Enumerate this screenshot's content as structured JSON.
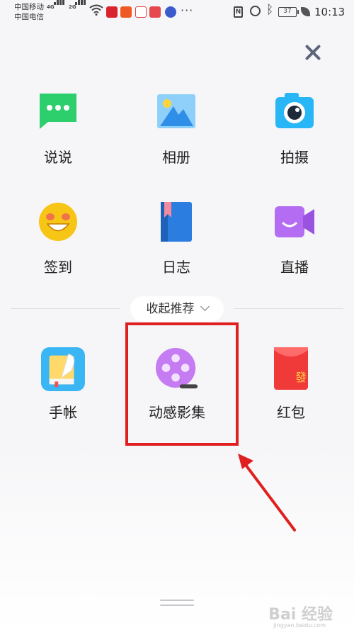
{
  "status_bar": {
    "carrier_1": "中国移动",
    "carrier_2": "中国电信",
    "net_1": "4G",
    "net_2": "2G",
    "nfc": "N",
    "battery": "37",
    "time": "10:13",
    "more": "···"
  },
  "close_icon": "close-icon",
  "grid": {
    "row1": [
      {
        "label": "说说",
        "icon": "chat-bubble-icon",
        "color": "#2ccf6c"
      },
      {
        "label": "相册",
        "icon": "photo-album-icon",
        "color": "#3aa7f5"
      },
      {
        "label": "拍摄",
        "icon": "camera-icon",
        "color": "#29b6f6"
      }
    ],
    "row2": [
      {
        "label": "签到",
        "icon": "smiley-face-icon",
        "color": "#f7c516"
      },
      {
        "label": "日志",
        "icon": "diary-book-icon",
        "color": "#2b7de0"
      },
      {
        "label": "直播",
        "icon": "video-camera-icon",
        "color": "#b46df2"
      }
    ],
    "row3": [
      {
        "label": "手帐",
        "icon": "notebook-feather-icon",
        "color": "#3ab6f4"
      },
      {
        "label": "动感影集",
        "icon": "film-reel-icon",
        "color": "#c57cf2"
      },
      {
        "label": "红包",
        "icon": "red-envelope-icon",
        "color": "#f03a3a"
      }
    ]
  },
  "collapse": {
    "label": "收起推荐",
    "icon": "chevron-down-icon"
  },
  "annotation": {
    "highlight_color": "#e02020"
  },
  "watermark": {
    "text": "Bai 经验",
    "sub": "jingyan.baidu.com"
  }
}
